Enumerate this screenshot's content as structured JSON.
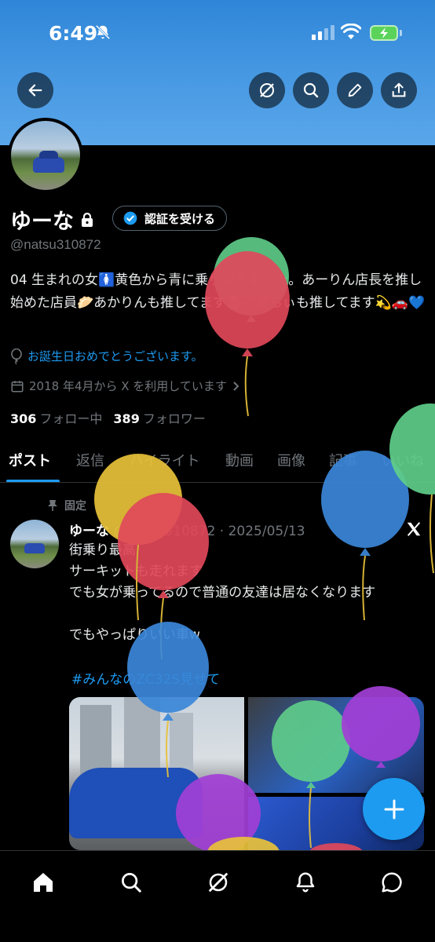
{
  "status_bar": {
    "time": "6:49"
  },
  "header": {
    "back": "back-arrow-icon",
    "actions": [
      "grok-icon",
      "search-icon",
      "edit-icon",
      "share-icon"
    ]
  },
  "profile": {
    "name": "ゆーな",
    "verify_button": "認証を受ける",
    "handle": "@natsu310872",
    "bio": "04 生まれの女🚺黄色から青に乗り換えました。あーりん店長を推し始めた店員🥟あかりんも推してます🍺ろあちぃも推してます💫🚗💙",
    "birthday": "お誕生日おめでとうございます。",
    "joined": "2018 年4月から X を利用しています",
    "following_count": "306",
    "following_label": "フォロー中",
    "followers_count": "389",
    "followers_label": "フォロワー"
  },
  "tabs": [
    "ポスト",
    "返信",
    "ハイライト",
    "動画",
    "画像",
    "記事",
    "いいね"
  ],
  "pinned_post": {
    "pinned_label": "固定",
    "author": "ゆーな",
    "meta": "@natsu310872 · 2025/05/13",
    "text": "街乗り最高\nサーキットも走れます\nでも女が乗ってるので普通の友達は居なくなります\n\nでもやっぱりいい車w",
    "hashtag": "#みんなのZC32S見せて"
  },
  "bottom_nav": [
    "home-icon",
    "search-icon",
    "grok-icon",
    "notifications-icon",
    "messages-icon"
  ],
  "colors": {
    "banner": "#3a8fde",
    "accent": "#1d9bf0",
    "muted": "#71767b",
    "balloon_red": "#e0485a",
    "balloon_green": "#5fce8a",
    "balloon_yellow": "#e8c13a",
    "balloon_blue": "#3b87d9",
    "balloon_purple": "#a23fd6"
  }
}
